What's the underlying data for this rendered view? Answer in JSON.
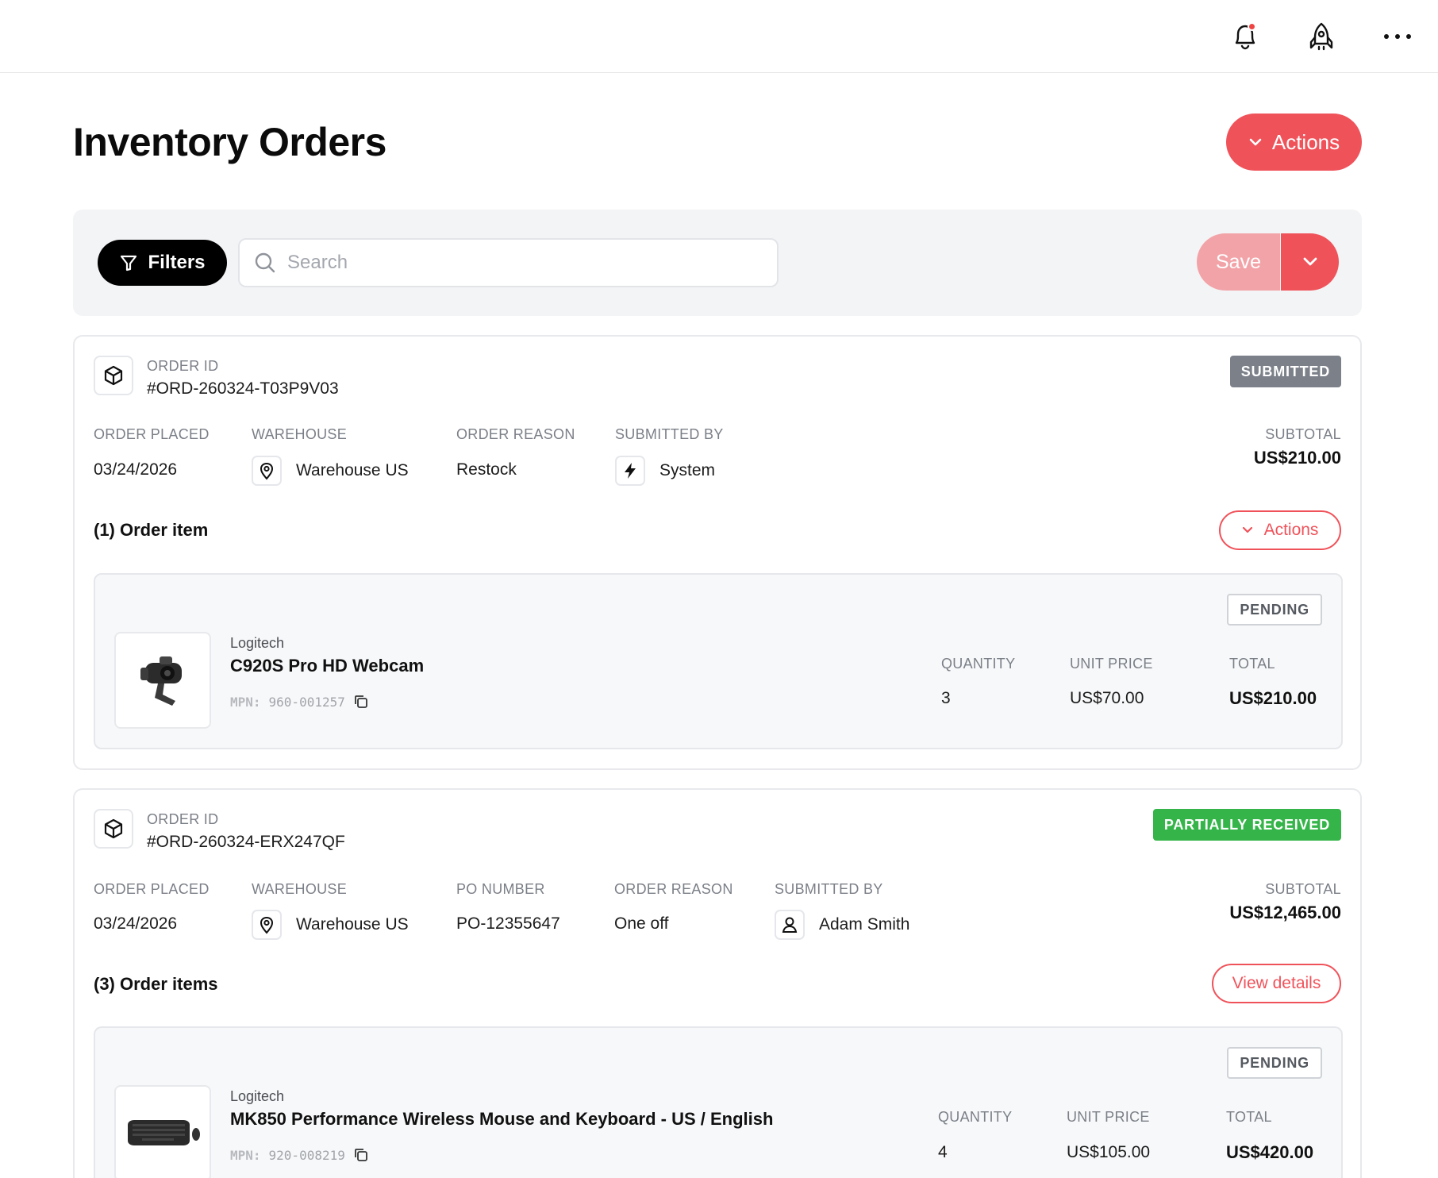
{
  "topbar": {
    "icons": [
      "bell-icon",
      "rocket-icon",
      "more-icon"
    ],
    "has_notification": true
  },
  "header": {
    "title": "Inventory Orders",
    "actions_label": "Actions"
  },
  "toolbar": {
    "filters_label": "Filters",
    "search_placeholder": "Search",
    "search_value": "",
    "save_label": "Save"
  },
  "colors": {
    "accent": "#f0525a",
    "accent_light": "#f2a3a8",
    "submitted": "#7b8089",
    "partially_received": "#35b549"
  },
  "orders": [
    {
      "id_label": "ORDER ID",
      "id": "#ORD-260324-T03P9V03",
      "status": "SUBMITTED",
      "placed_label": "ORDER PLACED",
      "placed": "03/24/2026",
      "warehouse_label": "WAREHOUSE",
      "warehouse": "Warehouse US",
      "reason_label": "ORDER REASON",
      "reason": "Restock",
      "submitted_by_label": "SUBMITTED BY",
      "submitted_by": "System",
      "subtotal_label": "SUBTOTAL",
      "subtotal": "US$210.00",
      "items_heading": "(1) Order item",
      "items_action": "Actions",
      "items": [
        {
          "brand": "Logitech",
          "name": "C920S Pro HD Webcam",
          "mpn_label": "MPN:",
          "mpn": "960-001257",
          "status": "PENDING",
          "quantity_label": "QUANTITY",
          "quantity": "3",
          "unit_price_label": "UNIT PRICE",
          "unit_price": "US$70.00",
          "total_label": "TOTAL",
          "total": "US$210.00"
        }
      ]
    },
    {
      "id_label": "ORDER ID",
      "id": "#ORD-260324-ERX247QF",
      "status": "PARTIALLY RECEIVED",
      "placed_label": "ORDER PLACED",
      "placed": "03/24/2026",
      "warehouse_label": "WAREHOUSE",
      "warehouse": "Warehouse US",
      "po_label": "PO NUMBER",
      "po": "PO-12355647",
      "reason_label": "ORDER REASON",
      "reason": "One off",
      "submitted_by_label": "SUBMITTED BY",
      "submitted_by": "Adam Smith",
      "subtotal_label": "SUBTOTAL",
      "subtotal": "US$12,465.00",
      "items_heading": "(3) Order items",
      "items_action": "View details",
      "items": [
        {
          "brand": "Logitech",
          "name": "MK850 Performance Wireless Mouse and Keyboard - US / English",
          "mpn_label": "MPN:",
          "mpn": "920-008219",
          "status": "PENDING",
          "quantity_label": "QUANTITY",
          "quantity": "4",
          "unit_price_label": "UNIT PRICE",
          "unit_price": "US$105.00",
          "total_label": "TOTAL",
          "total": "US$420.00"
        }
      ]
    }
  ]
}
